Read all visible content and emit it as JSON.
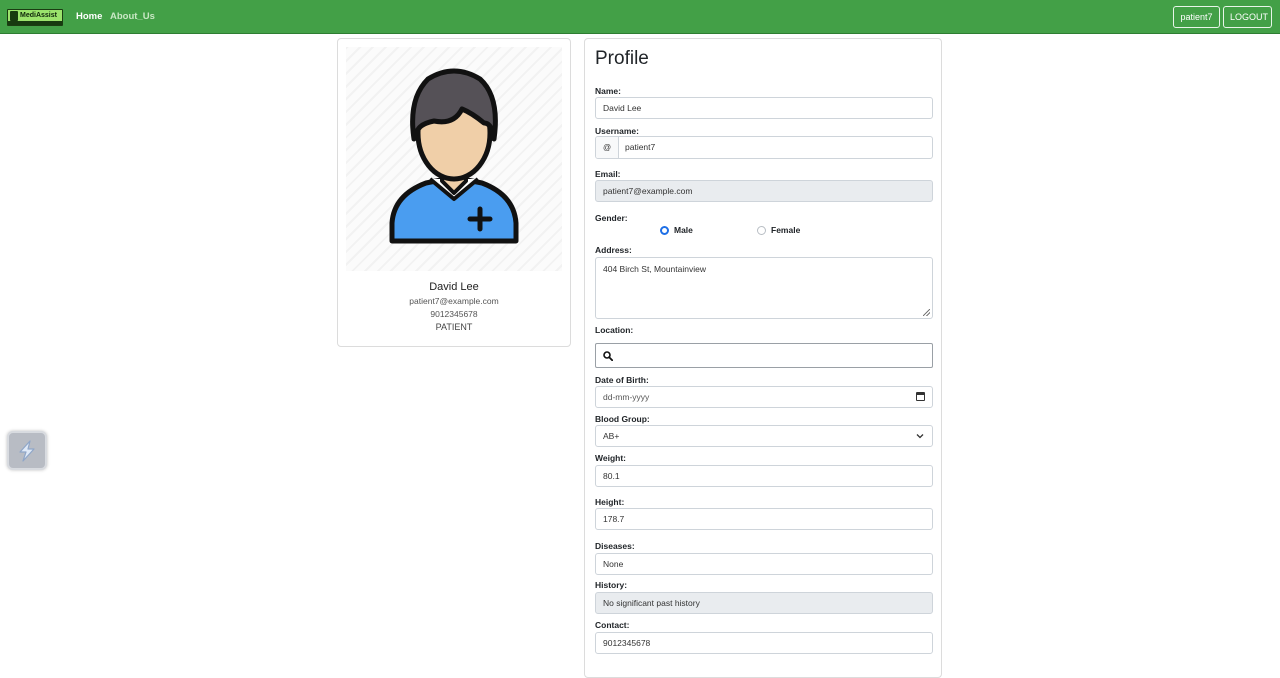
{
  "navbar": {
    "logo_text": "MediAssist",
    "links": [
      {
        "label": "Home"
      },
      {
        "label": "About_Us"
      }
    ],
    "user_button": "patient7",
    "logout_button": "LOGOUT"
  },
  "profile_card": {
    "name": "David Lee",
    "email": "patient7@example.com",
    "phone": "9012345678",
    "role": "PATIENT"
  },
  "form": {
    "title": "Profile",
    "name": {
      "label": "Name:",
      "value": "David Lee"
    },
    "username": {
      "label": "Username:",
      "prefix": "@",
      "value": "patient7"
    },
    "email": {
      "label": "Email:",
      "value": "patient7@example.com"
    },
    "gender": {
      "label": "Gender:",
      "options": [
        "Male",
        "Female"
      ],
      "selected": "Male"
    },
    "address": {
      "label": "Address:",
      "value": "404 Birch St, Mountainview"
    },
    "location": {
      "label": "Location:",
      "icon": "search-icon"
    },
    "dob": {
      "label": "Date of Birth:",
      "placeholder": "dd-mm-yyyy"
    },
    "blood_group": {
      "label": "Blood Group:",
      "value": "AB+"
    },
    "weight": {
      "label": "Weight:",
      "value": "80.1"
    },
    "height": {
      "label": "Height:",
      "value": "178.7"
    },
    "diseases": {
      "label": "Diseases:",
      "value": "None"
    },
    "history": {
      "label": "History:",
      "value": "No significant past history"
    },
    "contact": {
      "label": "Contact:",
      "value": "9012345678"
    }
  },
  "colors": {
    "navbar": "#43a047",
    "accent_radio": "#1e6fe6",
    "readonly_field": "#e9ecef",
    "avatar_shirt": "#4a9df0",
    "avatar_skin": "#f0cfa8",
    "avatar_hair": "#555157"
  }
}
